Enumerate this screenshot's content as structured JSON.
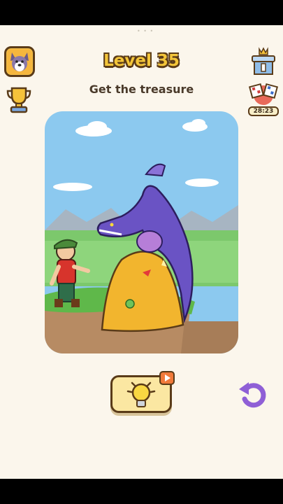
{
  "header": {
    "level_label": "Level 35",
    "instruction": "Get the treasure"
  },
  "top_right": {
    "race_timer": "28:23"
  },
  "icons": {
    "avatar": "dog-avatar-icon",
    "trophy": "trophy-icon",
    "leaderboard": "king-podium-icon",
    "race": "checkered-flags-icon",
    "hint": "lightbulb-icon",
    "video": "video-ad-icon",
    "undo": "undo-icon"
  },
  "colors": {
    "title_fill": "#f4c63a",
    "outline": "#5a3b18",
    "background": "#fbf6ec",
    "undo": "#8f5fd6"
  }
}
